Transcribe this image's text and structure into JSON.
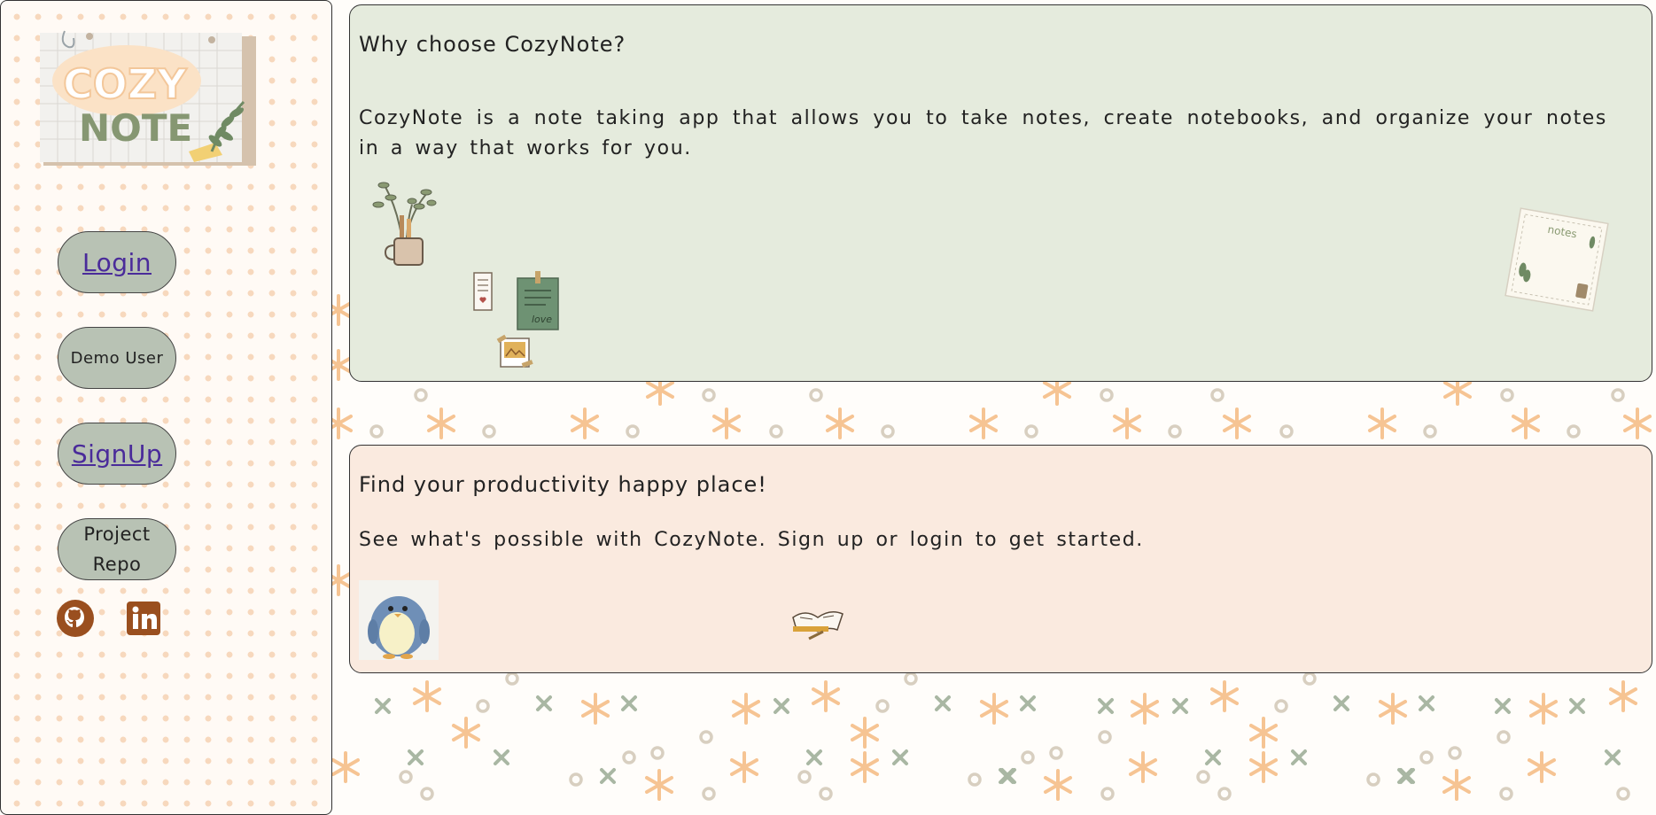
{
  "sidebar": {
    "logo": {
      "line1": "COZY",
      "line2": "NOTE"
    },
    "buttons": [
      {
        "label": "Login"
      },
      {
        "label": "Demo User"
      },
      {
        "label": "SignUp"
      },
      {
        "label": "Project Repo"
      }
    ],
    "social": [
      {
        "icon": "github-icon"
      },
      {
        "icon": "linkedin-icon"
      }
    ]
  },
  "main": {
    "card1": {
      "title": "Why choose CozyNote?",
      "text": "CozyNote is a note taking app that allows you to take notes, create notebooks, and organize your notes in a way that works for you.",
      "sticky_note_label": "notes",
      "love_note_label": "love"
    },
    "card2": {
      "title": "Find your productivity happy place!",
      "text": "See what's possible with CozyNote. Sign up or login to get started."
    }
  },
  "colors": {
    "card1_bg": "#e5ebdd",
    "card2_bg": "#faeadf",
    "button_bg": "#b8c2b4",
    "link_color": "#4a2b9a",
    "social_brown": "#9a4f1f"
  }
}
